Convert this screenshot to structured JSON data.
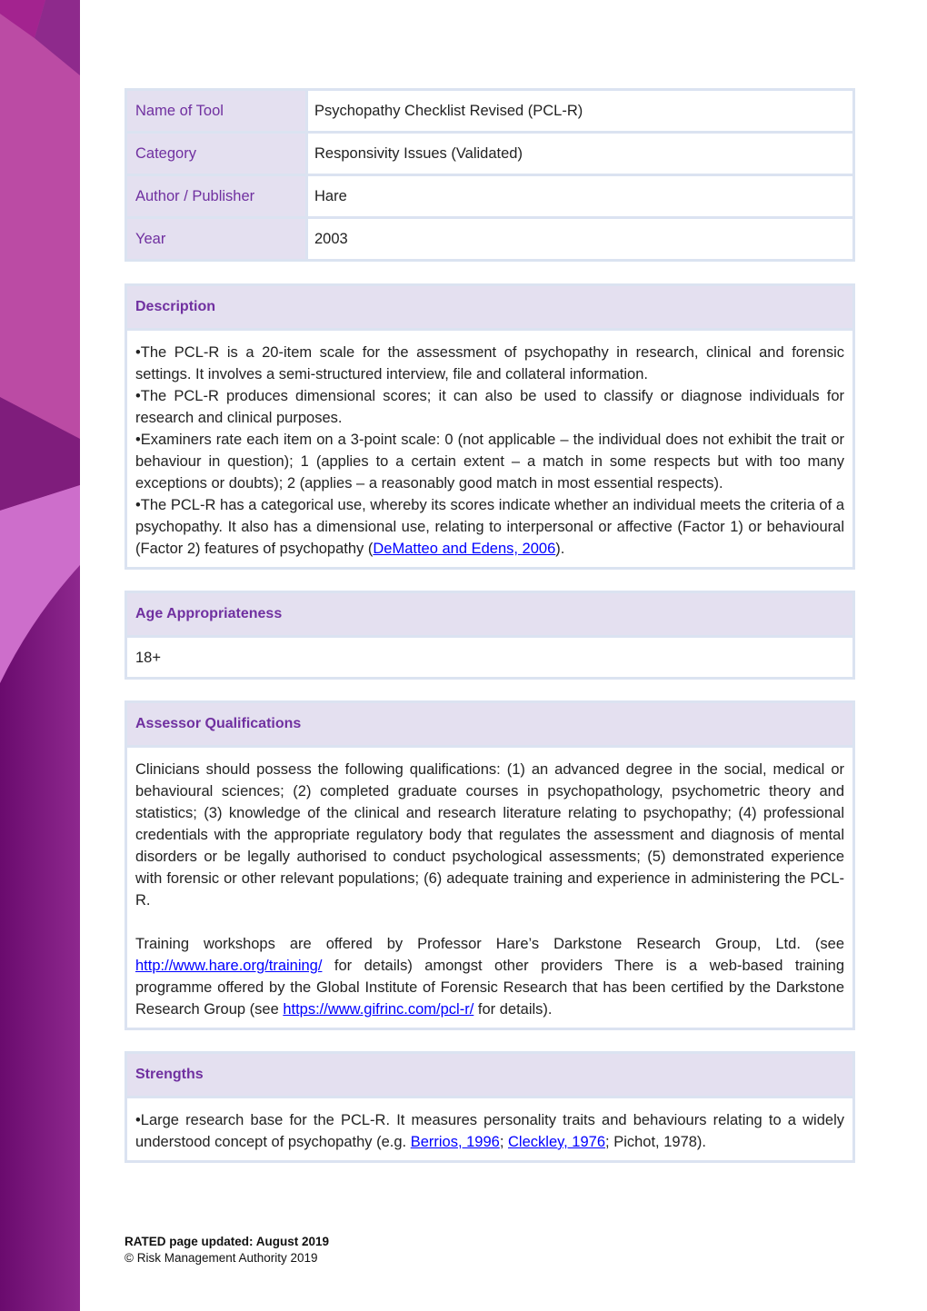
{
  "info_table": [
    {
      "label": "Name of Tool",
      "value": "Psychopathy Checklist Revised (PCL-R)"
    },
    {
      "label": "Category",
      "value": "Responsivity Issues (Validated)"
    },
    {
      "label": "Author / Publisher",
      "value": "Hare"
    },
    {
      "label": "Year",
      "value": "2003"
    }
  ],
  "description": {
    "heading": "Description",
    "bullet": "•",
    "items": [
      "The PCL-R is a 20-item scale for the assessment of psychopathy in research, clinical and forensic settings. It involves a semi-structured interview, file and collateral information.",
      "The PCL-R produces dimensional scores; it can also be used to classify or diagnose individuals for research and clinical purposes.",
      "Examiners rate each item on a 3-point scale: 0 (not applicable – the individual does not exhibit the trait or behaviour in question); 1 (applies to a certain extent – a match in some respects but with too many exceptions or doubts); 2 (applies – a reasonably good match in most essential respects).",
      "The PCL-R has a categorical use, whereby its scores indicate whether an individual meets the criteria of a psychopathy. It also has a dimensional use, relating to interpersonal or affective (Factor 1) or behavioural (Factor 2) features of psychopathy ("
    ],
    "last_link": "DeMatteo and Edens, 2006",
    "last_suffix": ")."
  },
  "age": {
    "heading": "Age Appropriateness",
    "value": "18+"
  },
  "qualifications": {
    "heading": "Assessor Qualifications",
    "paragraph1": "Clinicians should possess the following qualifications: (1) an advanced degree in the social, medical or behavioural sciences; (2) completed graduate courses in psychopathology, psychometric theory and statistics; (3) knowledge of the clinical and research literature relating to psychopathy; (4) professional credentials with the appropriate regulatory body that regulates the assessment and diagnosis of mental disorders or be legally authorised to conduct psychological assessments; (5) demonstrated experience with forensic or other relevant populations; (6) adequate training and experience in administering the PCL-R.",
    "p2_part1": "Training workshops are offered by Professor Hare’s Darkstone Research Group, Ltd. (see ",
    "p2_link1": "http://www.hare.org/training/",
    "p2_part2": " for details) amongst other providers There is a web-based training programme offered by the Global Institute of Forensic Research that has been certified by the Darkstone Research Group (see ",
    "p2_link2": "https://www.gifrinc.com/pcl-r/",
    "p2_part3": " for details)."
  },
  "strengths": {
    "heading": "Strengths",
    "bullet": "•",
    "text1": "Large research base for the PCL-R. It measures personality traits and behaviours relating to a widely understood concept of psychopathy (e.g. ",
    "link1": "Berrios, 1996",
    "sep": "; ",
    "link2": "Cleckley, 1976",
    "text2": "; Pichot, 1978)."
  },
  "footer": {
    "updated": "RATED page updated: August 2019",
    "copyright": "© Risk Management Authority 2019"
  },
  "colors": {
    "accent_purple": "#7030a0",
    "header_bg": "#e4e0f0",
    "border": "#dbe3f1",
    "link": "#0000ff"
  }
}
